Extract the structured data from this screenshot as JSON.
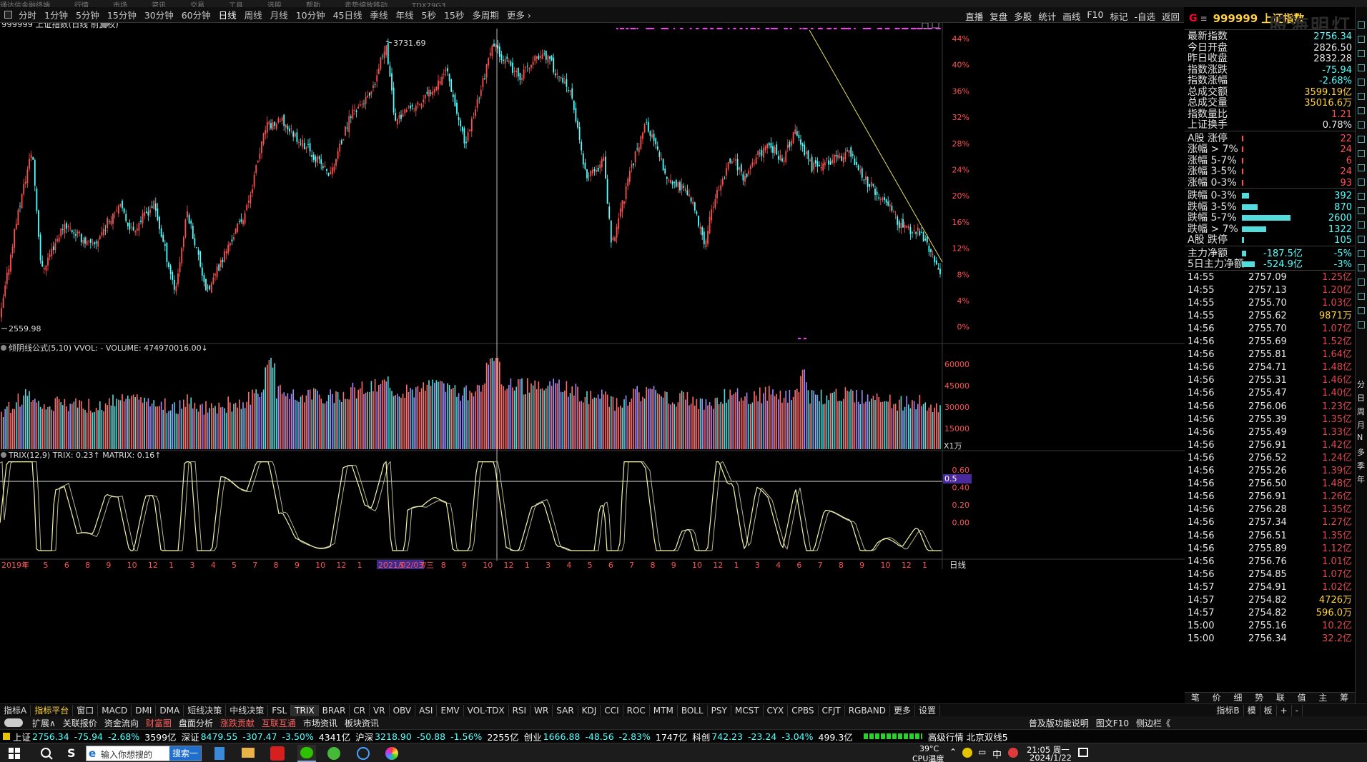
{
  "top_menu": [
    "通达信金融终端",
    "行情",
    "市场",
    "资讯",
    "交易",
    "工具",
    "选股",
    "帮助",
    "走势缩放移动",
    "TDX79G3"
  ],
  "period_bar": {
    "items": [
      "分时",
      "1分钟",
      "5分钟",
      "15分钟",
      "30分钟",
      "60分钟",
      "日线",
      "周线",
      "月线",
      "10分钟",
      "45日线",
      "季线",
      "年线",
      "5秒",
      "15秒",
      "多周期",
      "更多 ›"
    ],
    "active": "日线",
    "right_items": [
      "直播",
      "复盘",
      "多股",
      "统计",
      "画线",
      "F10",
      "标记",
      "-自选",
      "返回"
    ]
  },
  "chart": {
    "title": "999999 上证指数(日线 前复权)",
    "high_label": "3731.69",
    "low_label": "2559.98",
    "pct_labels": [
      "44%",
      "40%",
      "36%",
      "32%",
      "28%",
      "24%",
      "20%",
      "16%",
      "12%",
      "8%",
      "4%",
      "0%"
    ],
    "volume_title": "倾阴线公式(5,10)  VVOL: -  VOLUME: 474970016.00↓",
    "volume_axis": [
      "60000",
      "45000",
      "30000",
      "15000"
    ],
    "volume_unit": "X1万",
    "trix_title": "TRIX(12,9)  TRIX: 0.23↑  MATRIX: 0.16↑",
    "trix_axis": [
      "0.60",
      "0.40",
      "0.20",
      "0.00"
    ],
    "trix_ref_label": "0.5",
    "x_labels": [
      "2019年",
      "4",
      "5",
      "6",
      "8",
      "9",
      "10",
      "12",
      "1",
      "3",
      "4",
      "5",
      "7",
      "8",
      "9",
      "10",
      "12",
      "1",
      "2021/02/03/三",
      "5",
      "7",
      "8",
      "9",
      "10",
      "12",
      "1",
      "3",
      "4",
      "5",
      "6",
      "7",
      "8",
      "9",
      "10",
      "12",
      "1",
      "3",
      "4",
      "6",
      "7",
      "8",
      "9",
      "10",
      "12",
      "1"
    ],
    "period_label": "日线"
  },
  "quote": {
    "flag": "G",
    "name": "999999 上证指数",
    "watermark": "股海明灯",
    "rows": [
      {
        "k": "最新指数",
        "v": "2756.34"
      },
      {
        "k": "今日开盘",
        "v": "2826.50"
      },
      {
        "k": "昨日收盘",
        "v": "2832.28"
      },
      {
        "k": "指数涨跌",
        "v": "-75.94"
      },
      {
        "k": "指数涨幅",
        "v": "-2.68%"
      },
      {
        "k": "总成交额",
        "v": "3599.19亿"
      },
      {
        "k": "总成交量",
        "v": "35016.6万"
      },
      {
        "k": "指数量比",
        "v": "1.21"
      },
      {
        "k": "上证换手",
        "v": "0.78%"
      }
    ],
    "breadth": [
      {
        "k": "A股 涨停",
        "v": "22",
        "bar": 0.02
      },
      {
        "k": "涨幅 > 7%",
        "v": "24",
        "bar": 0.02
      },
      {
        "k": "涨幅 5-7%",
        "v": "6",
        "bar": 0.01
      },
      {
        "k": "涨幅 3-5%",
        "v": "24",
        "bar": 0.02
      },
      {
        "k": "涨幅 0-3%",
        "v": "93",
        "bar": 0.03
      },
      {
        "k": "跌幅 0-3%",
        "v": "392",
        "bar": 0.15
      },
      {
        "k": "跌幅 3-5%",
        "v": "870",
        "bar": 0.33
      },
      {
        "k": "跌幅 5-7%",
        "v": "2600",
        "bar": 1.0
      },
      {
        "k": "跌幅 > 7%",
        "v": "1322",
        "bar": 0.5
      },
      {
        "k": "A股 跌停",
        "v": "105",
        "bar": 0.04
      }
    ],
    "flows": [
      {
        "k": "主力净额",
        "v": "-187.5亿",
        "pct": "-5%"
      },
      {
        "k": "5日主力净额",
        "v": "-524.9亿",
        "pct": "-3%"
      }
    ],
    "ticks": [
      [
        "14:55",
        "2757.09",
        "1.25亿"
      ],
      [
        "14:55",
        "2757.13",
        "1.20亿"
      ],
      [
        "14:55",
        "2755.70",
        "1.03亿"
      ],
      [
        "14:55",
        "2755.62",
        "9871万"
      ],
      [
        "14:56",
        "2755.70",
        "1.07亿"
      ],
      [
        "14:56",
        "2755.69",
        "1.52亿"
      ],
      [
        "14:56",
        "2755.81",
        "1.64亿"
      ],
      [
        "14:56",
        "2754.71",
        "1.48亿"
      ],
      [
        "14:56",
        "2755.31",
        "1.46亿"
      ],
      [
        "14:56",
        "2755.47",
        "1.40亿"
      ],
      [
        "14:56",
        "2756.06",
        "1.23亿"
      ],
      [
        "14:56",
        "2755.39",
        "1.35亿"
      ],
      [
        "14:56",
        "2755.49",
        "1.33亿"
      ],
      [
        "14:56",
        "2756.91",
        "1.42亿"
      ],
      [
        "14:56",
        "2756.52",
        "1.24亿"
      ],
      [
        "14:56",
        "2755.26",
        "1.39亿"
      ],
      [
        "14:56",
        "2756.50",
        "1.48亿"
      ],
      [
        "14:56",
        "2756.91",
        "1.26亿"
      ],
      [
        "14:56",
        "2756.28",
        "1.35亿"
      ],
      [
        "14:56",
        "2757.34",
        "1.27亿"
      ],
      [
        "14:56",
        "2756.51",
        "1.35亿"
      ],
      [
        "14:56",
        "2755.89",
        "1.12亿"
      ],
      [
        "14:56",
        "2756.76",
        "1.01亿"
      ],
      [
        "14:56",
        "2754.85",
        "1.07亿"
      ],
      [
        "14:57",
        "2754.91",
        "1.02亿"
      ],
      [
        "14:57",
        "2754.82",
        "4726万"
      ],
      [
        "14:57",
        "2754.82",
        "596.0万"
      ],
      [
        "15:00",
        "2755.16",
        "10.2亿"
      ],
      [
        "15:00",
        "2756.34",
        "32.2亿"
      ]
    ],
    "bottom_tabs": [
      "笔",
      "价",
      "细",
      "势",
      "联",
      "值",
      "主",
      "筹"
    ]
  },
  "side_icons": [
    "分",
    "日",
    "周",
    "月",
    "N",
    "多",
    "季",
    "年"
  ],
  "indicator_tabs": [
    "指标A",
    "指标平台",
    "窗口",
    "MACD",
    "DMI",
    "DMA",
    "短线决策",
    "中线决策",
    "FSL",
    "TRIX",
    "BRAR",
    "CR",
    "VR",
    "OBV",
    "ASI",
    "EMV",
    "VOL-TDX",
    "RSI",
    "WR",
    "SAR",
    "KDJ",
    "CCI",
    "ROC",
    "MTM",
    "BOLL",
    "PSY",
    "MCST",
    "CYX",
    "CPBS",
    "CFJT",
    "RGBAND",
    "更多",
    "设置"
  ],
  "indicator_right": [
    "指标B",
    "模",
    "板",
    "+",
    "-"
  ],
  "sub_tabs": [
    {
      "t": "扩展∧",
      "red": false
    },
    {
      "t": "关联报价",
      "red": false
    },
    {
      "t": "资金流向",
      "red": false
    },
    {
      "t": "财富圈",
      "red": true
    },
    {
      "t": "盘面分析",
      "red": false
    },
    {
      "t": "涨跌贡献",
      "red": true
    },
    {
      "t": "互联互通",
      "red": true
    },
    {
      "t": "市场资讯",
      "red": false
    },
    {
      "t": "板块资讯",
      "red": false
    }
  ],
  "sub_right": [
    "普及版功能说明",
    "图文F10",
    "侧边栏《"
  ],
  "index_bar": [
    {
      "name": "上证",
      "last": "2756.34",
      "chg": "-75.94",
      "pct": "-2.68%",
      "amt": "3599亿"
    },
    {
      "name": "深证",
      "last": "8479.55",
      "chg": "-307.47",
      "pct": "-3.50%",
      "amt": "4341亿"
    },
    {
      "name": "沪深",
      "last": "3218.90",
      "chg": "-50.88",
      "pct": "-1.56%",
      "amt": "2255亿"
    },
    {
      "name": "创业",
      "last": "1666.88",
      "chg": "-48.56",
      "pct": "-2.83%",
      "amt": "1747亿"
    },
    {
      "name": "科创",
      "last": "742.23",
      "chg": "-23.24",
      "pct": "-3.04%",
      "amt": "499.3亿"
    }
  ],
  "index_bar_tail": "高级行情 北京双线5",
  "taskbar": {
    "search_text": "输入你想搜的",
    "search_btn": "搜索一下",
    "temp": "39°C",
    "temp_label": "CPU温度",
    "ime": "中",
    "time": "21:05 周一",
    "date": "2024/1/22"
  },
  "colors": {
    "up": "#ff5050",
    "down": "#54ffff",
    "yellow": "#ffd23f",
    "magenta": "#ff39ff",
    "trix": "#f5f5a8"
  }
}
